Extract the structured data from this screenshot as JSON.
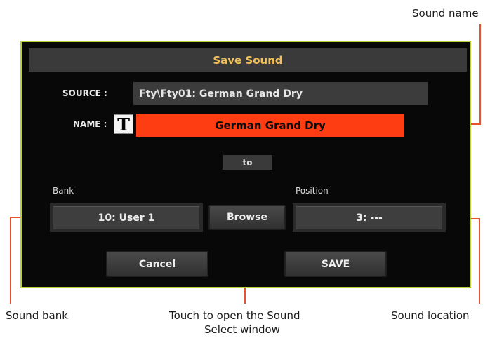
{
  "callouts": {
    "sound_name": "Sound name",
    "sound_bank": "Sound bank",
    "browse_hint_line1": "Touch to open the Sound",
    "browse_hint_line2": "Select window",
    "sound_location": "Sound location"
  },
  "dialog": {
    "title": "Save Sound",
    "source_label": "SOURCE :",
    "source_value": "Fty\\Fty01: German Grand Dry",
    "name_label": "NAME :",
    "text_edit_icon": "T",
    "name_value": "German Grand Dry",
    "to_label": "to",
    "bank_label": "Bank",
    "bank_value": "10: User 1",
    "browse_button": "Browse",
    "position_label": "Position",
    "position_value": "3: ---",
    "cancel_button": "Cancel",
    "save_button": "SAVE"
  },
  "colors": {
    "accent_border": "#b6d234",
    "title_text": "#f2c05a",
    "name_field": "#ff3d12",
    "callout_line": "#e8522f"
  }
}
